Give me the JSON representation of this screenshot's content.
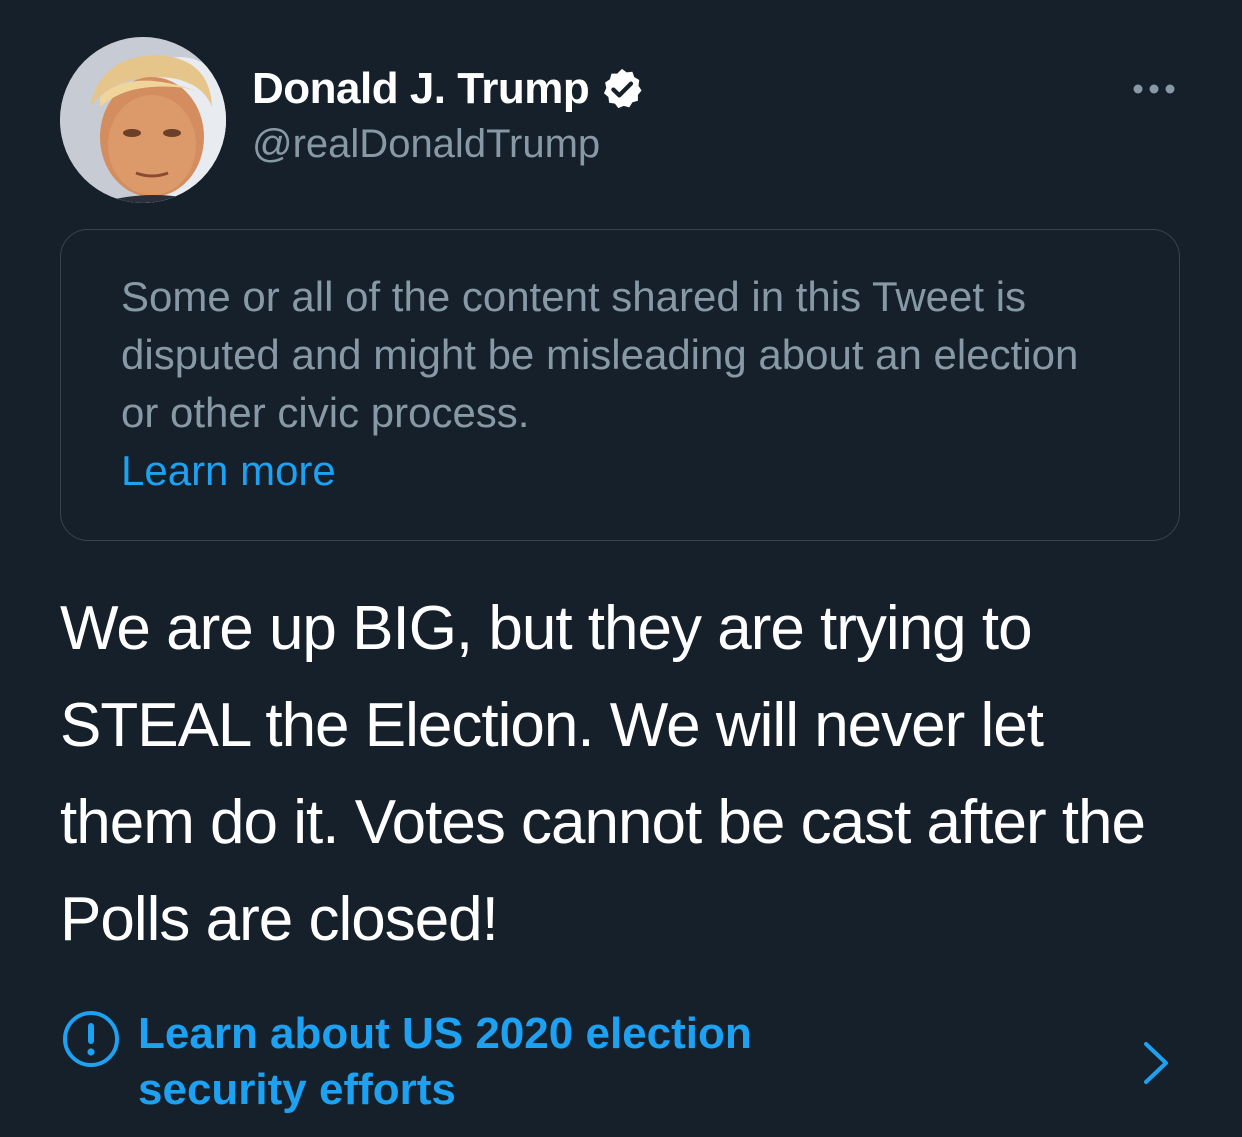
{
  "author": {
    "display_name": "Donald J. Trump",
    "handle": "@realDonaldTrump",
    "verified": true,
    "avatar_icon": "profile-photo"
  },
  "menu": {
    "icon": "more-horizontal-icon"
  },
  "notice": {
    "text": "Some or all of the content shared in this Tweet is disputed and might be misleading about an election or other civic process.",
    "link_label": "Learn more"
  },
  "tweet": {
    "text": "We are up BIG, but they are trying to STEAL the Election. We will never let them do it. Votes cannot be cast after the Polls are closed!"
  },
  "election_link": {
    "icon": "alert-circle-icon",
    "label_line1": "Learn about US 2020 election",
    "label_line2": "security efforts",
    "chevron_icon": "chevron-right-icon"
  },
  "colors": {
    "background": "#15202b",
    "accent": "#1da1f2",
    "secondary_text": "#8899a6",
    "border": "#38444d"
  }
}
